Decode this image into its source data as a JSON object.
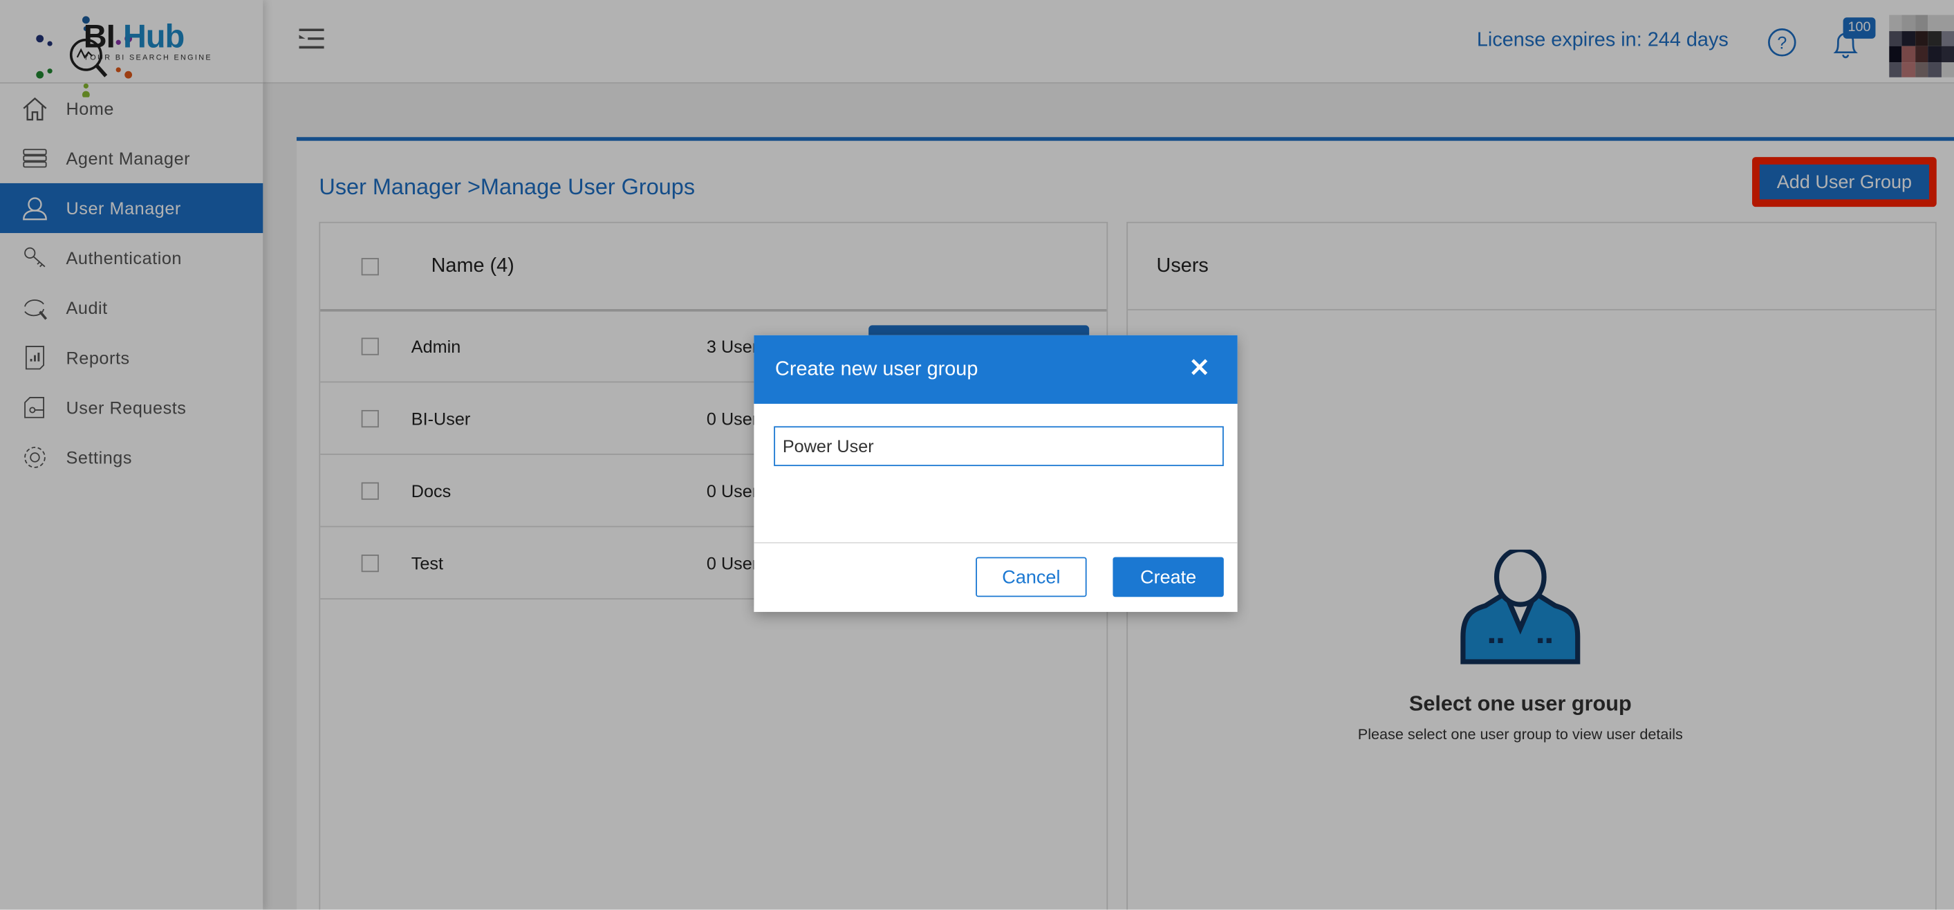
{
  "brand": {
    "name_part1": "BI",
    "name_part2": "Hub",
    "tagline": "YOUR BI SEARCH ENGINE"
  },
  "header": {
    "license_text": "License expires in: 244 days",
    "notification_count": "100",
    "menu_icon": "menu-collapse-icon",
    "help_icon": "help-circle-icon",
    "bell_icon": "bell-icon"
  },
  "sidebar": {
    "items": [
      {
        "label": "Home",
        "icon": "home-icon"
      },
      {
        "label": "Agent Manager",
        "icon": "server-icon"
      },
      {
        "label": "User Manager",
        "icon": "user-icon",
        "active": true
      },
      {
        "label": "Authentication",
        "icon": "keys-icon"
      },
      {
        "label": "Audit",
        "icon": "audit-icon"
      },
      {
        "label": "Reports",
        "icon": "report-icon"
      },
      {
        "label": "User Requests",
        "icon": "user-request-icon"
      },
      {
        "label": "Settings",
        "icon": "gear-icon"
      }
    ]
  },
  "breadcrumb": {
    "parent": "User Manager",
    "separator": ">",
    "current": "Manage User Groups"
  },
  "toolbar": {
    "add_label": "Add User Group"
  },
  "groups": {
    "header": "Name (4)",
    "rows": [
      {
        "name": "Admin",
        "count": "3 Users"
      },
      {
        "name": "BI-User",
        "count": "0 Users"
      },
      {
        "name": "Docs",
        "count": "0 Users"
      },
      {
        "name": "Test",
        "count": "0 Users"
      }
    ]
  },
  "users_panel": {
    "header": "Users",
    "empty_title": "Select one user group",
    "empty_text": "Please select one user group to view user details"
  },
  "modal": {
    "title": "Create new user group",
    "input_value": "Power User",
    "cancel_label": "Cancel",
    "create_label": "Create"
  },
  "colors": {
    "accent": "#1d6fc4",
    "modal_header": "#1b78d2",
    "highlight": "#ff2200"
  }
}
